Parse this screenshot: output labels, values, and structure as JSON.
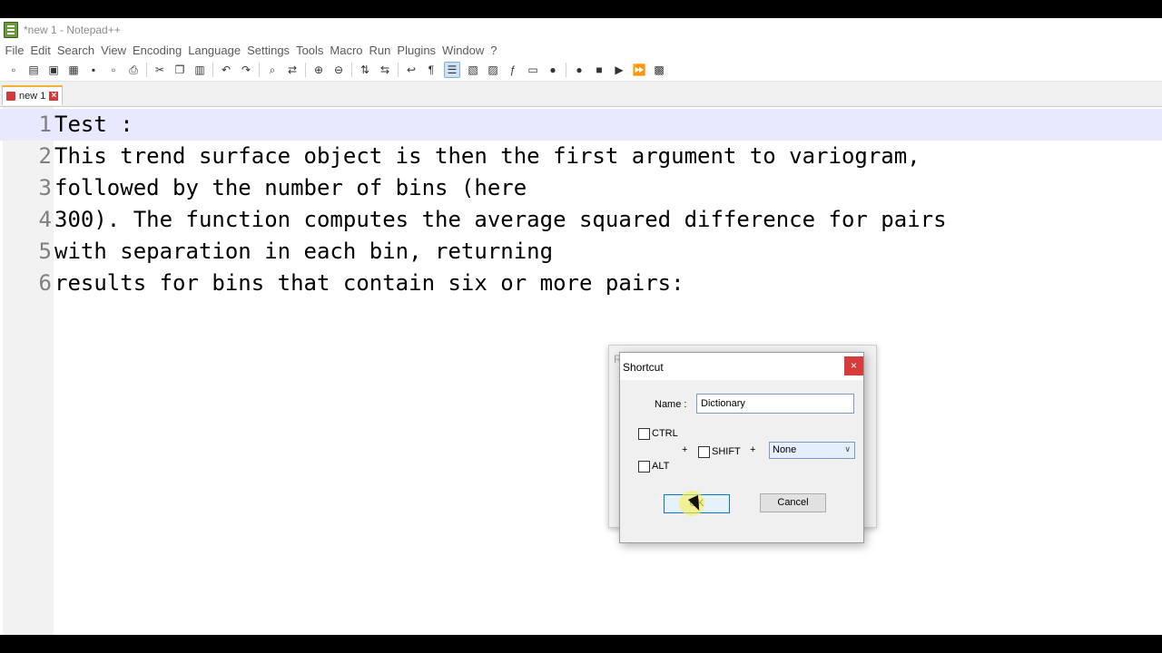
{
  "window": {
    "title": "*new 1 - Notepad++"
  },
  "menu": [
    "File",
    "Edit",
    "Search",
    "View",
    "Encoding",
    "Language",
    "Settings",
    "Tools",
    "Macro",
    "Run",
    "Plugins",
    "Window",
    "?"
  ],
  "toolbar": {
    "icons": [
      "new-file-icon",
      "open-file-icon",
      "save-icon",
      "save-all-icon",
      "close-icon",
      "close-all-icon",
      "print-icon",
      "sep",
      "cut-icon",
      "copy-icon",
      "paste-icon",
      "sep",
      "undo-icon",
      "redo-icon",
      "sep",
      "find-icon",
      "replace-icon",
      "sep",
      "zoom-in-icon",
      "zoom-out-icon",
      "sep",
      "sync-vertical-icon",
      "sync-horizontal-icon",
      "sep",
      "word-wrap-icon",
      "show-all-chars-icon",
      "indent-guide-icon",
      "user-defined-lang-icon",
      "doc-map-icon",
      "function-list-icon",
      "folder-workspace-icon",
      "monitoring-icon",
      "sep",
      "record-macro-icon",
      "stop-macro-icon",
      "play-macro-icon",
      "run-macro-multiple-icon",
      "save-macro-icon"
    ],
    "glyphs": {
      "new-file-icon": "▫",
      "open-file-icon": "▤",
      "save-icon": "▣",
      "save-all-icon": "▦",
      "close-icon": "▪",
      "close-all-icon": "▫",
      "print-icon": "⎙",
      "cut-icon": "✂",
      "copy-icon": "❐",
      "paste-icon": "▥",
      "undo-icon": "↶",
      "redo-icon": "↷",
      "find-icon": "⌕",
      "replace-icon": "⇄",
      "zoom-in-icon": "⊕",
      "zoom-out-icon": "⊖",
      "sync-vertical-icon": "⇅",
      "sync-horizontal-icon": "⇆",
      "word-wrap-icon": "↩",
      "show-all-chars-icon": "¶",
      "indent-guide-icon": "☰",
      "user-defined-lang-icon": "▧",
      "doc-map-icon": "▨",
      "function-list-icon": "ƒ",
      "folder-workspace-icon": "▭",
      "monitoring-icon": "●",
      "record-macro-icon": "●",
      "stop-macro-icon": "■",
      "play-macro-icon": "▶",
      "run-macro-multiple-icon": "⏩",
      "save-macro-icon": "▩"
    },
    "active": "indent-guide-icon"
  },
  "tabs": [
    {
      "label": "new 1"
    }
  ],
  "editor": {
    "lines": [
      "Test :",
      "This trend surface object is then the first argument to variogram,",
      "followed by the number of bins (here",
      "300). The function computes the average squared difference for pairs",
      "with separation in each bin, returning",
      "results for bins that contain six or more pairs:"
    ],
    "current_line": 1
  },
  "background_dialog": {
    "title_fragment": "R"
  },
  "dialog": {
    "title": "Shortcut",
    "close_label": "×",
    "name_label": "Name :",
    "name_value": "Dictionary",
    "ctrl_label": "CTRL",
    "alt_label": "ALT",
    "shift_label": "SHIFT",
    "plus1": "+",
    "plus2": "+",
    "ctrl_checked": false,
    "alt_checked": false,
    "shift_checked": false,
    "key_value": "None",
    "ok_label": "OK",
    "cancel_label": "Cancel"
  }
}
